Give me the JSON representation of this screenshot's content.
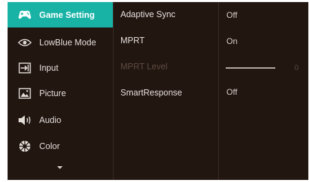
{
  "menu": {
    "items": [
      {
        "label": "Game Setting",
        "icon": "gamepad-icon",
        "active": true
      },
      {
        "label": "LowBlue Mode",
        "icon": "eye-icon",
        "active": false
      },
      {
        "label": "Input",
        "icon": "input-icon",
        "active": false
      },
      {
        "label": "Picture",
        "icon": "picture-icon",
        "active": false
      },
      {
        "label": "Audio",
        "icon": "speaker-icon",
        "active": false
      },
      {
        "label": "Color",
        "icon": "color-wheel-icon",
        "active": false
      }
    ],
    "more_icon": "chevron-down-icon"
  },
  "submenu": {
    "items": [
      {
        "label": "Adaptive Sync",
        "enabled": true
      },
      {
        "label": "MPRT",
        "enabled": true
      },
      {
        "label": "MPRT Level",
        "enabled": false
      },
      {
        "label": "SmartResponse",
        "enabled": true
      }
    ]
  },
  "values": {
    "adaptive_sync": "Off",
    "mprt": "On",
    "mprt_level": "0",
    "smartresponse": "Off"
  },
  "colors": {
    "accent": "#19b3a6",
    "background": "#221611",
    "disabled_text": "#5c4b42"
  }
}
